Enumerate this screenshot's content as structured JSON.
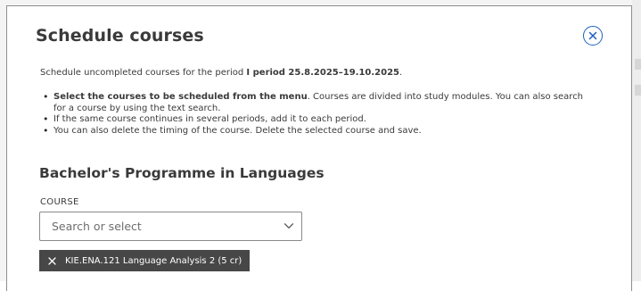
{
  "dialog": {
    "title": "Schedule courses",
    "close_icon": "close-circle-icon"
  },
  "intro": {
    "text": "Schedule uncompleted courses for the period ",
    "period": "I period 25.8.2025–19.10.2025",
    "suffix": "."
  },
  "instructions": [
    {
      "bold": "Select the courses to be scheduled from the menu",
      "text": ". Courses are divided into study modules. You can also search for a course by using the text search."
    },
    {
      "bold": "",
      "text": "If the same course continues in several periods, add it to each period."
    },
    {
      "bold": "",
      "text": "You can also delete the timing of the course. Delete the selected course and save."
    }
  ],
  "programme": {
    "heading": "Bachelor's Programme in Languages"
  },
  "course_field": {
    "label": "COURSE",
    "placeholder": "Search or select",
    "value": "",
    "dropdown_icon": "chevron-down-icon"
  },
  "selected_courses": [
    {
      "label": "KIE.ENA.121 Language Analysis 2 (5 cr)",
      "remove_icon": "close-icon"
    }
  ],
  "colors": {
    "accent": "#1f5fbf",
    "chip_bg": "#474747",
    "text": "#3a3a3a",
    "border": "#8a8a8a"
  }
}
